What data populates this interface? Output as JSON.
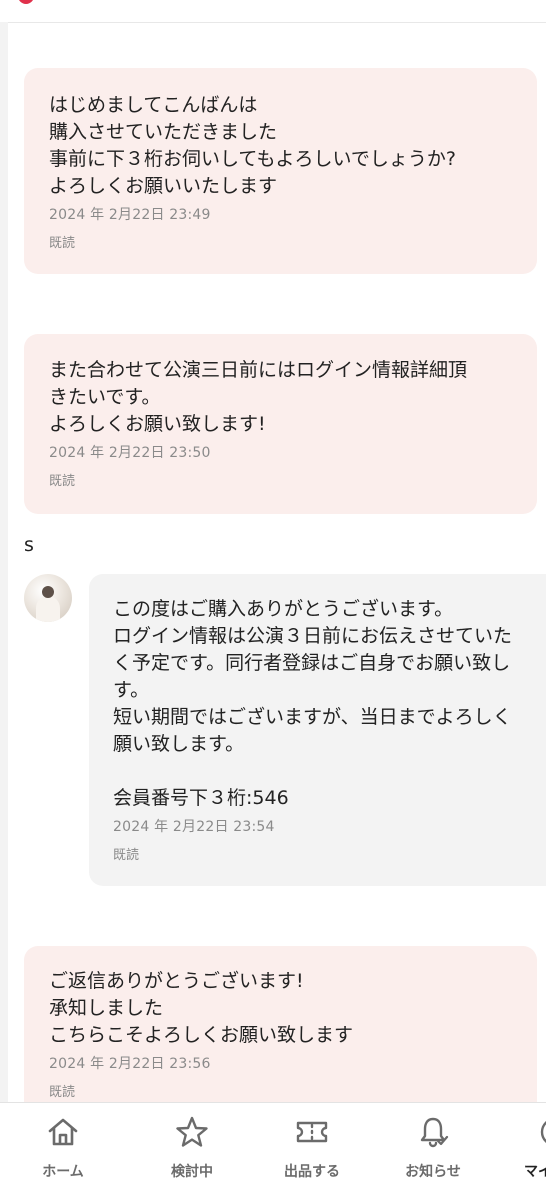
{
  "messages": [
    {
      "text": "はじめましてこんばんは\n購入させていただきました\n事前に下３桁お伺いしてもよろしいでしょうか?\nよろしくお願いいたします",
      "time": "2024 年 2月22日  23:49",
      "status": "既読"
    },
    {
      "text": "また合わせて公演三日前にはログイン情報詳細頂\nきたいです。\nよろしくお願い致します!",
      "time": "2024 年 2月22日  23:50",
      "status": "既読"
    },
    {
      "sender": "s",
      "text": "この度はご購入ありがとうございます。\nログイン情報は公演３日前にお伝えさせていた\nく予定です。同行者登録はご自身でお願い致し\nす。\n短い期間ではございますが、当日までよろしく\n願い致します。\n\n会員番号下３桁:546",
      "time": "2024 年 2月22日  23:54",
      "status": "既読"
    },
    {
      "text": "ご返信ありがとうございます!\n承知しました\nこちらこそよろしくお願い致します",
      "time": "2024 年 2月22日  23:56",
      "status": "既読"
    }
  ],
  "nav": {
    "items": [
      {
        "label": "ホーム",
        "icon": "home-icon"
      },
      {
        "label": "検討中",
        "icon": "star-icon"
      },
      {
        "label": "出品する",
        "icon": "ticket-icon"
      },
      {
        "label": "お知らせ",
        "icon": "bell-icon"
      },
      {
        "label": "マイ",
        "icon": "mypage-icon"
      }
    ]
  },
  "colors": {
    "mine_bubble": "#fbeeec",
    "theirs_bubble": "#f3f3f3",
    "nav_gray": "#6b6b6b"
  }
}
